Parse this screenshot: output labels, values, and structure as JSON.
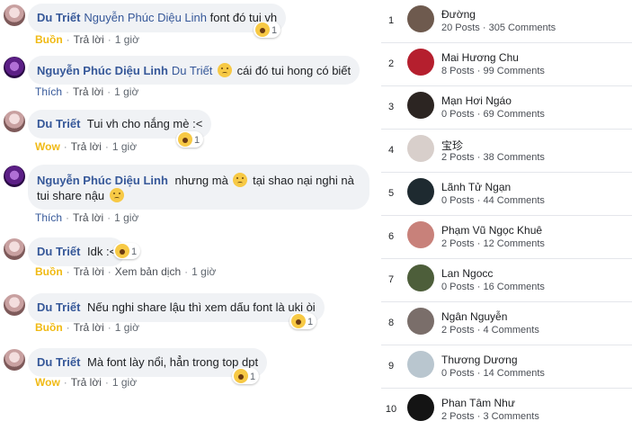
{
  "comments": [
    {
      "author": "Du Triết",
      "mention": "Nguyễn Phúc Diệu Linh",
      "text": "font đó tui vh",
      "text2": "",
      "text_tail": "",
      "reaction_count": "1",
      "reaction_word": "Buồn",
      "reply": "Trả lời",
      "extra": "",
      "time": "1 giờ"
    },
    {
      "author": "Nguyễn Phúc Diệu Linh",
      "mention": "Du Triết",
      "text": "",
      "text2": "cái đó tui hong có biết",
      "text_tail": "",
      "reaction_count": "",
      "reaction_word": "Thích",
      "reply": "Trả lời",
      "extra": "",
      "time": "1 giờ"
    },
    {
      "author": "Du Triết",
      "mention": "",
      "text": "Tui vh cho nắng mè :<",
      "text2": "",
      "text_tail": "",
      "reaction_count": "1",
      "reaction_word": "Wow",
      "reply": "Trả lời",
      "extra": "",
      "time": "1 giờ"
    },
    {
      "author": "Nguyễn Phúc Diệu Linh",
      "mention": "",
      "text": "nhưng mà",
      "text2": "tại shao nại nghi nà tui share nậu",
      "text_tail": "",
      "reaction_count": "",
      "reaction_word": "Thích",
      "reply": "Trả lời",
      "extra": "",
      "time": "1 giờ"
    },
    {
      "author": "Du Triết",
      "mention": "",
      "text": "Idk :<",
      "text2": "",
      "text_tail": "",
      "reaction_count": "1",
      "reaction_word": "Buồn",
      "reply": "Trả lời",
      "extra": "Xem bản dịch",
      "time": "1 giờ"
    },
    {
      "author": "Du Triết",
      "mention": "",
      "text": "Nếu nghi share lậu thì xem dấu font là uki òi",
      "text2": "",
      "text_tail": "",
      "reaction_count": "1",
      "reaction_word": "Buồn",
      "reply": "Trả lời",
      "extra": "",
      "time": "1 giờ"
    },
    {
      "author": "Du Triết",
      "mention": "",
      "text": "Mà font lày nổi, hẳn trong top dpt",
      "text2": "",
      "text_tail": "",
      "reaction_count": "1",
      "reaction_word": "Wow",
      "reply": "Trả lời",
      "extra": "",
      "time": "1 giờ"
    }
  ],
  "leaderboard": [
    {
      "rank": "1",
      "name": "Đường",
      "stats": "20 Posts · 305 Comments"
    },
    {
      "rank": "2",
      "name": "Mai Hương Chu",
      "stats": "8 Posts · 99 Comments"
    },
    {
      "rank": "3",
      "name": "Mạn Hơi Ngáo",
      "stats": "0 Posts · 69 Comments"
    },
    {
      "rank": "4",
      "name": "宝珍",
      "stats": "2 Posts · 38 Comments"
    },
    {
      "rank": "5",
      "name": "Lãnh Tử Ngạn",
      "stats": "0 Posts · 44 Comments"
    },
    {
      "rank": "6",
      "name": "Phạm Vũ Ngọc Khuê",
      "stats": "2 Posts · 12 Comments"
    },
    {
      "rank": "7",
      "name": "Lan Ngocc",
      "stats": "0 Posts · 16 Comments"
    },
    {
      "rank": "8",
      "name": "Ngân Nguyễn",
      "stats": "2 Posts · 4 Comments"
    },
    {
      "rank": "9",
      "name": "Thương Dương",
      "stats": "0 Posts · 14 Comments"
    },
    {
      "rank": "10",
      "name": "Phan Tâm Như",
      "stats": "2 Posts · 3 Comments"
    }
  ],
  "colors": {
    "author": "#365899",
    "reaction_yellow": "#f0ba15",
    "bubble": "#f0f2f5"
  }
}
